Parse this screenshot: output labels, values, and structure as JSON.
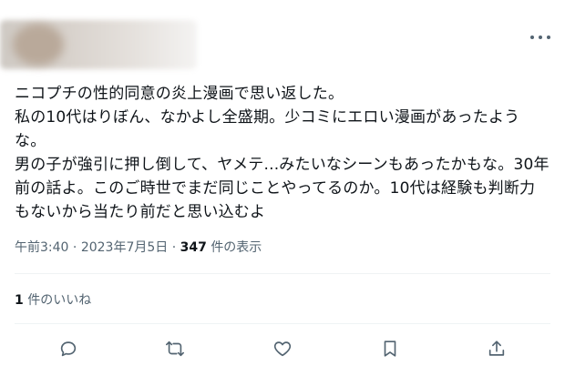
{
  "tweet": {
    "text": "ニコプチの性的同意の炎上漫画で思い返した。\n私の10代はりぼん、なかよし全盛期。少コミにエロい漫画があったような。\n男の子が強引に押し倒して、ヤメテ...みたいなシーンもあったかもな。30年前の話よ。このご時世でまだ同じことやってるのか。10代は経験も判断力もないから当たり前だと思い込むよ",
    "time": "午前3:40",
    "separator": "·",
    "date": "2023年7月5日",
    "views_count": "347",
    "views_label": "件の表示",
    "likes_count": "1",
    "likes_label": "件のいいね"
  },
  "actions": [
    {
      "icon": "reply-icon"
    },
    {
      "icon": "retweet-icon"
    },
    {
      "icon": "like-icon"
    },
    {
      "icon": "bookmark-icon"
    },
    {
      "icon": "share-icon"
    }
  ],
  "colors": {
    "text": "#0f1419",
    "secondary": "#536471",
    "divider": "#eff3f4"
  }
}
